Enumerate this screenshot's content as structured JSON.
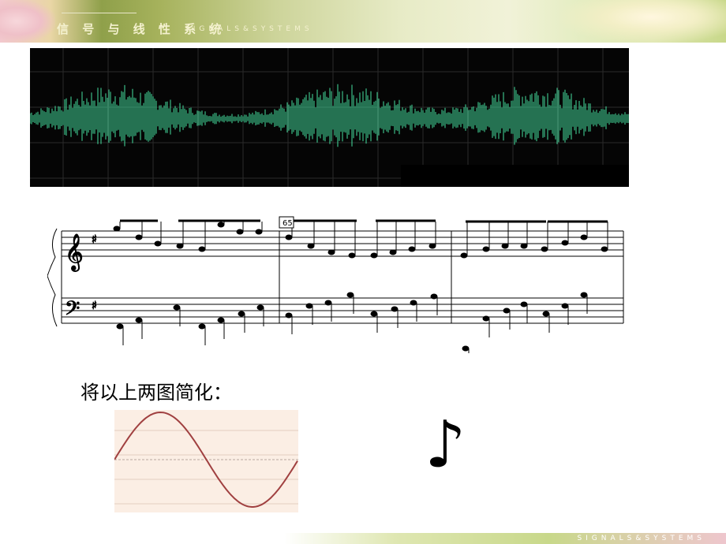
{
  "header": {
    "title": "信 号 与 线 性 系 统",
    "subtitle": "SIGNALS&SYSTEMS"
  },
  "footer": {
    "text": "SIGNALS&SYSTEMS"
  },
  "score": {
    "measure_number": "65"
  },
  "caption": "将以上两图简化：",
  "note_symbol": "♪",
  "colors": {
    "waveform": "#45e0a0",
    "sine_curve": "#a04040",
    "sine_background": "#fbeee4"
  }
}
